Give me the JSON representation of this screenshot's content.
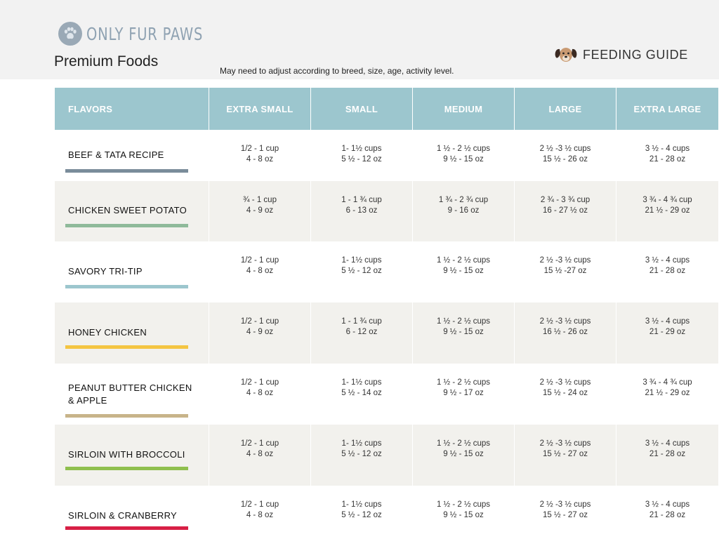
{
  "header": {
    "brand": "ONLY FUR PAWS",
    "title": "Premium Foods",
    "note": "May need to adjust according to breed, size, age, activity level.",
    "guide": "FEEDING GUIDE"
  },
  "table": {
    "columns": [
      "FLAVORS",
      "EXTRA SMALL",
      "SMALL",
      "MEDIUM",
      "LARGE",
      "EXTRA LARGE"
    ],
    "rows": [
      {
        "flavor": "BEEF & TATA RECIPE",
        "bar_color": "#7a8c9a",
        "cells": [
          [
            "1/2 - 1 cup",
            "4 - 8 oz"
          ],
          [
            "1- 1½ cups",
            "5 ½ - 12 oz"
          ],
          [
            "1 ½ - 2 ½ cups",
            "9 ½ - 15 oz"
          ],
          [
            "2 ½ -3 ½ cups",
            "15 ½ - 26 oz"
          ],
          [
            "3 ½ - 4 cups",
            "21 - 28 oz"
          ]
        ]
      },
      {
        "flavor": "CHICKEN SWEET POTATO",
        "bar_color": "#8fba9a",
        "cells": [
          [
            "¾  -  1 cup",
            "4 - 9 oz"
          ],
          [
            "1 - 1 ¾ cup",
            "6 - 13 oz"
          ],
          [
            "1 ¾ - 2 ¾ cup",
            "9 - 16 oz"
          ],
          [
            "2 ¾ - 3 ¾ cup",
            "16 - 27 ½ oz"
          ],
          [
            "3 ¾ - 4 ¾ cup",
            "21 ½ - 29 oz"
          ]
        ]
      },
      {
        "flavor": "SAVORY TRI-TIP",
        "bar_color": "#9cc6ce",
        "cells": [
          [
            "1/2 - 1 cup",
            "4 - 8 oz"
          ],
          [
            "1- 1½ cups",
            "5 ½ - 12 oz"
          ],
          [
            "1 ½ - 2 ½ cups",
            "9 ½ - 15 oz"
          ],
          [
            "2 ½ -3 ½ cups",
            "15 ½  -27 oz"
          ],
          [
            "3 ½ - 4 cups",
            "21 - 28 oz"
          ]
        ]
      },
      {
        "flavor": "HONEY CHICKEN",
        "bar_color": "#f4c542",
        "cells": [
          [
            "1/2 - 1 cup",
            "4 - 9 oz"
          ],
          [
            "1 - 1 ¾ cup",
            "6 - 12 oz"
          ],
          [
            "1 ½ - 2 ½ cups",
            "9 ½ - 15 oz"
          ],
          [
            "2 ½ -3 ½ cups",
            "16 ½ - 26 oz"
          ],
          [
            "3 ½ - 4 cups",
            "21 - 29 oz"
          ]
        ]
      },
      {
        "flavor": "PEANUT BUTTER CHICKEN & APPLE",
        "flavor_lines": [
          "PEANUT BUTTER CHICKEN",
          "& APPLE"
        ],
        "bar_color": "#c8b48a",
        "cells": [
          [
            "1/2 - 1 cup",
            "4 - 8 oz"
          ],
          [
            "1- 1½ cups",
            "5 ½ - 14 oz"
          ],
          [
            "1 ½ - 2 ½ cups",
            "9 ½ - 17 oz"
          ],
          [
            "2 ½ -3 ½ cups",
            "15 ½ - 24 oz"
          ],
          [
            "3 ¾ - 4 ¾ cup",
            "21 ½ - 29 oz"
          ]
        ]
      },
      {
        "flavor": "SIRLOIN WITH BROCCOLI",
        "bar_color": "#8fbf4e",
        "cells": [
          [
            "1/2 - 1 cup",
            "4 - 8 oz"
          ],
          [
            "1- 1½ cups",
            "5 ½ - 12 oz"
          ],
          [
            "1 ½ - 2 ½ cups",
            "9 ½ - 15 oz"
          ],
          [
            "2 ½ -3 ½ cups",
            "15 ½ - 27 oz"
          ],
          [
            "3 ½ - 4 cups",
            "21 - 28 oz"
          ]
        ]
      },
      {
        "flavor": "SIRLOIN & CRANBERRY",
        "bar_color": "#d81f45",
        "cells": [
          [
            "1/2 - 1 cup",
            "4 - 8 oz"
          ],
          [
            "1- 1½ cups",
            "5 ½ - 12 oz"
          ],
          [
            "1 ½ - 2 ½ cups",
            "9 ½ - 15 oz"
          ],
          [
            "2 ½ -3 ½ cups",
            "15 ½ - 27 oz"
          ],
          [
            "3 ½ - 4 cups",
            "21 - 28 oz"
          ]
        ]
      }
    ]
  }
}
